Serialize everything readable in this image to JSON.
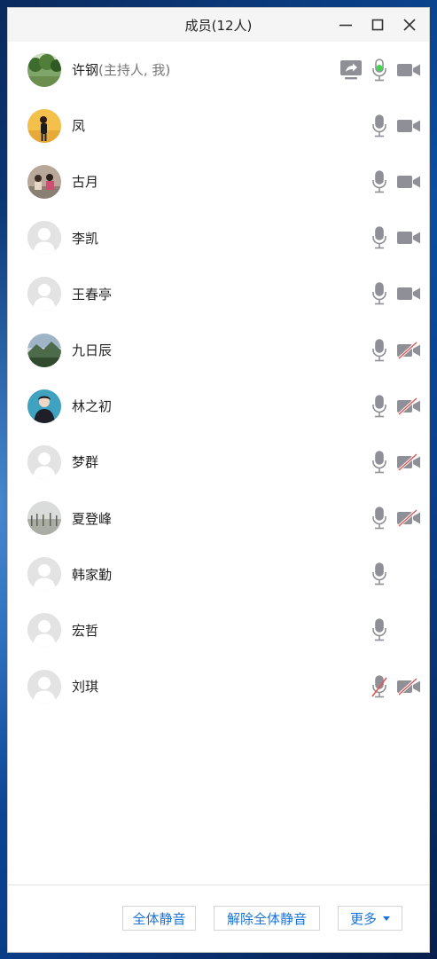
{
  "window": {
    "title": "成员(12人)",
    "controls": [
      "minimize-icon",
      "maximize-icon",
      "close-icon"
    ]
  },
  "members": [
    {
      "name": "许钢",
      "role": "(主持人, 我)",
      "avatar": "photo-trees",
      "share": true,
      "mic": "active",
      "video": "on"
    },
    {
      "name": "凤",
      "role": "",
      "avatar": "photo-person-yellow",
      "share": false,
      "mic": "on",
      "video": "on"
    },
    {
      "name": "古月",
      "role": "",
      "avatar": "photo-people",
      "share": false,
      "mic": "on",
      "video": "on"
    },
    {
      "name": "李凯",
      "role": "",
      "avatar": "default",
      "share": false,
      "mic": "on",
      "video": "on"
    },
    {
      "name": "王春亭",
      "role": "",
      "avatar": "default",
      "share": false,
      "mic": "on",
      "video": "on"
    },
    {
      "name": "九日辰",
      "role": "",
      "avatar": "photo-landscape",
      "share": false,
      "mic": "on",
      "video": "off"
    },
    {
      "name": "林之初",
      "role": "",
      "avatar": "photo-person-teal",
      "share": false,
      "mic": "on",
      "video": "off"
    },
    {
      "name": "梦群",
      "role": "",
      "avatar": "default",
      "share": false,
      "mic": "on",
      "video": "off"
    },
    {
      "name": "夏登峰",
      "role": "",
      "avatar": "photo-fog",
      "share": false,
      "mic": "on",
      "video": "off"
    },
    {
      "name": "韩家勤",
      "role": "",
      "avatar": "default",
      "share": false,
      "mic": "on",
      "video": "none"
    },
    {
      "name": "宏哲",
      "role": "",
      "avatar": "default",
      "share": false,
      "mic": "on",
      "video": "none"
    },
    {
      "name": "刘琪",
      "role": "",
      "avatar": "default",
      "share": false,
      "mic": "muted",
      "video": "off"
    }
  ],
  "footer": {
    "mute_all": "全体静音",
    "unmute_all": "解除全体静音",
    "more": "更多"
  },
  "colors": {
    "icon_gray": "#8f8f98",
    "mic_active": "#3fd44a",
    "muted_slash": "#e25555",
    "link_blue": "#1a73d9"
  }
}
